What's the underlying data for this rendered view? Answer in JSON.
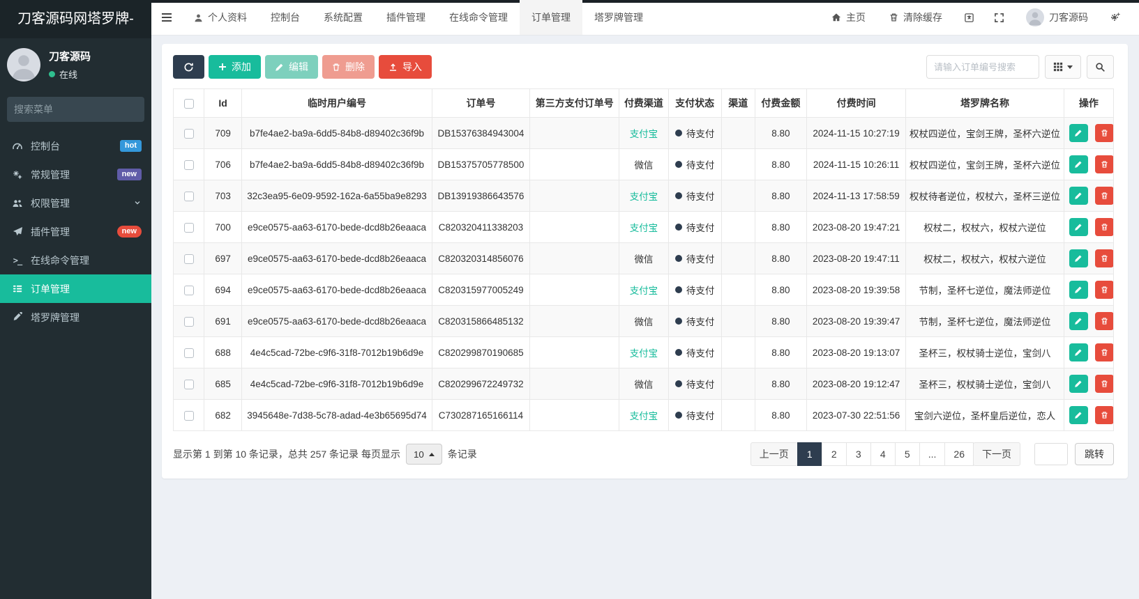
{
  "brand": "刀客源码网塔罗牌-",
  "theme": {
    "accent_teal": "#18bc9c",
    "accent_red": "#e74c3c",
    "dark_navy": "#2e3d4f",
    "sidebar_bg": "#222d32"
  },
  "sidebar": {
    "user": {
      "name": "刀客源码",
      "status": "在线"
    },
    "search_placeholder": "搜索菜单",
    "items": [
      {
        "label": "控制台",
        "icon": "dashboard-icon",
        "badge": "hot",
        "badge_style": "blue"
      },
      {
        "label": "常规管理",
        "icon": "gears-icon",
        "badge": "new",
        "badge_style": "purple"
      },
      {
        "label": "权限管理",
        "icon": "users-icon",
        "chevron": true
      },
      {
        "label": "插件管理",
        "icon": "paper-plane-icon",
        "badge": "new",
        "badge_style": "red-pill"
      },
      {
        "label": "在线命令管理",
        "icon": "terminal-icon"
      },
      {
        "label": "订单管理",
        "icon": "list-icon",
        "active": true
      },
      {
        "label": "塔罗牌管理",
        "icon": "pen-icon"
      }
    ]
  },
  "navbar": {
    "items": [
      {
        "label": "个人资料",
        "icon": "user-icon"
      },
      {
        "label": "控制台"
      },
      {
        "label": "系统配置"
      },
      {
        "label": "插件管理"
      },
      {
        "label": "在线命令管理"
      },
      {
        "label": "订单管理",
        "active": true
      },
      {
        "label": "塔罗牌管理"
      }
    ],
    "right": {
      "home": "主页",
      "clear_cache": "清除缓存",
      "user_name": "刀客源码"
    }
  },
  "toolbar": {
    "add": "添加",
    "edit": "编辑",
    "delete": "删除",
    "import": "导入",
    "search_placeholder": "请输入订单编号搜索"
  },
  "table": {
    "columns": [
      "Id",
      "临时用户编号",
      "订单号",
      "第三方支付订单号",
      "付费渠道",
      "支付状态",
      "渠道",
      "付费金额",
      "付费时间",
      "塔罗牌名称",
      "操作"
    ],
    "rows": [
      {
        "id": "709",
        "temp_user_id": "b7fe4ae2-ba9a-6dd5-84b8-d89402c36f9b",
        "order_no": "DB15376384943004",
        "third_party_no": "",
        "pay_channel": "支付宝",
        "channel_highlight": true,
        "pay_status": "待支付",
        "channel": "",
        "amount": "8.80",
        "pay_time": "2024-11-15 10:27:19",
        "tarot_names": "权杖四逆位，宝剑王牌，圣杯六逆位"
      },
      {
        "id": "706",
        "temp_user_id": "b7fe4ae2-ba9a-6dd5-84b8-d89402c36f9b",
        "order_no": "DB15375705778500",
        "third_party_no": "",
        "pay_channel": "微信",
        "channel_highlight": false,
        "pay_status": "待支付",
        "channel": "",
        "amount": "8.80",
        "pay_time": "2024-11-15 10:26:11",
        "tarot_names": "权杖四逆位，宝剑王牌，圣杯六逆位"
      },
      {
        "id": "703",
        "temp_user_id": "32c3ea95-6e09-9592-162a-6a55ba9e8293",
        "order_no": "DB13919386643576",
        "third_party_no": "",
        "pay_channel": "支付宝",
        "channel_highlight": true,
        "pay_status": "待支付",
        "channel": "",
        "amount": "8.80",
        "pay_time": "2024-11-13 17:58:59",
        "tarot_names": "权杖待者逆位，权杖六，圣杯三逆位"
      },
      {
        "id": "700",
        "temp_user_id": "e9ce0575-aa63-6170-bede-dcd8b26eaaca",
        "order_no": "C820320411338203",
        "third_party_no": "",
        "pay_channel": "支付宝",
        "channel_highlight": true,
        "pay_status": "待支付",
        "channel": "",
        "amount": "8.80",
        "pay_time": "2023-08-20 19:47:21",
        "tarot_names": "权杖二，权杖六，权杖六逆位"
      },
      {
        "id": "697",
        "temp_user_id": "e9ce0575-aa63-6170-bede-dcd8b26eaaca",
        "order_no": "C820320314856076",
        "third_party_no": "",
        "pay_channel": "微信",
        "channel_highlight": false,
        "pay_status": "待支付",
        "channel": "",
        "amount": "8.80",
        "pay_time": "2023-08-20 19:47:11",
        "tarot_names": "权杖二，权杖六，权杖六逆位"
      },
      {
        "id": "694",
        "temp_user_id": "e9ce0575-aa63-6170-bede-dcd8b26eaaca",
        "order_no": "C820315977005249",
        "third_party_no": "",
        "pay_channel": "支付宝",
        "channel_highlight": true,
        "pay_status": "待支付",
        "channel": "",
        "amount": "8.80",
        "pay_time": "2023-08-20 19:39:58",
        "tarot_names": "节制，圣杯七逆位，魔法师逆位"
      },
      {
        "id": "691",
        "temp_user_id": "e9ce0575-aa63-6170-bede-dcd8b26eaaca",
        "order_no": "C820315866485132",
        "third_party_no": "",
        "pay_channel": "微信",
        "channel_highlight": false,
        "pay_status": "待支付",
        "channel": "",
        "amount": "8.80",
        "pay_time": "2023-08-20 19:39:47",
        "tarot_names": "节制，圣杯七逆位，魔法师逆位"
      },
      {
        "id": "688",
        "temp_user_id": "4e4c5cad-72be-c9f6-31f8-7012b19b6d9e",
        "order_no": "C820299870190685",
        "third_party_no": "",
        "pay_channel": "支付宝",
        "channel_highlight": true,
        "pay_status": "待支付",
        "channel": "",
        "amount": "8.80",
        "pay_time": "2023-08-20 19:13:07",
        "tarot_names": "圣杯三，权杖骑士逆位，宝剑八"
      },
      {
        "id": "685",
        "temp_user_id": "4e4c5cad-72be-c9f6-31f8-7012b19b6d9e",
        "order_no": "C820299672249732",
        "third_party_no": "",
        "pay_channel": "微信",
        "channel_highlight": false,
        "pay_status": "待支付",
        "channel": "",
        "amount": "8.80",
        "pay_time": "2023-08-20 19:12:47",
        "tarot_names": "圣杯三，权杖骑士逆位，宝剑八"
      },
      {
        "id": "682",
        "temp_user_id": "3945648e-7d38-5c78-adad-4e3b65695d74",
        "order_no": "C730287165166114",
        "third_party_no": "",
        "pay_channel": "支付宝",
        "channel_highlight": true,
        "pay_status": "待支付",
        "channel": "",
        "amount": "8.80",
        "pay_time": "2023-07-30 22:51:56",
        "tarot_names": "宝剑六逆位，圣杯皇后逆位，恋人"
      }
    ]
  },
  "pagination": {
    "info_prefix": "显示第 1 到第 10 条记录，总共 257 条记录 每页显示",
    "page_size": "10",
    "info_suffix": "条记录",
    "prev": "上一页",
    "next": "下一页",
    "pages": [
      "1",
      "2",
      "3",
      "4",
      "5",
      "...",
      "26"
    ],
    "active_page": "1",
    "jump_value": "",
    "jump_label": "跳转"
  }
}
